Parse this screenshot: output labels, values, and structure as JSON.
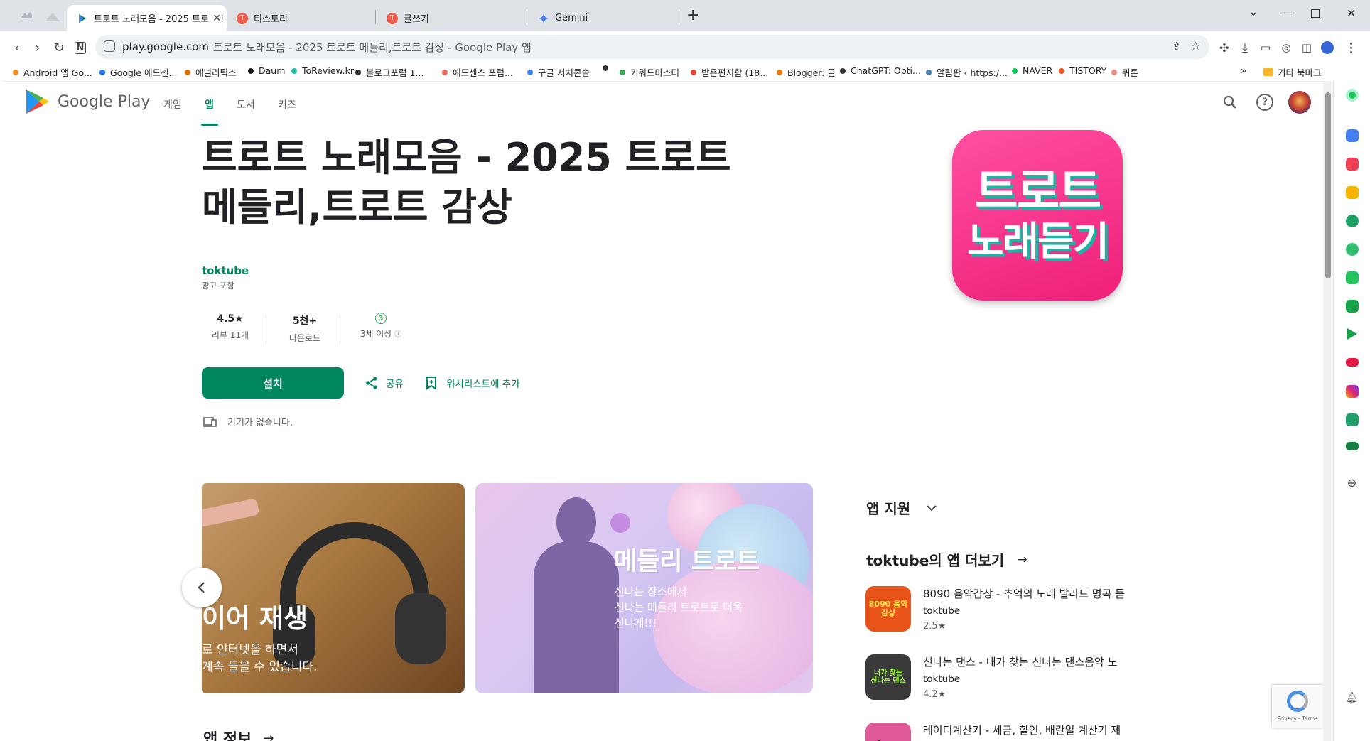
{
  "browser": {
    "tabs": [
      {
        "label": "트로트 노래모음 - 2025 트로트 !",
        "icon": "google-play-icon",
        "active": true
      },
      {
        "label": "티스토리",
        "icon": "tistory-icon",
        "active": false
      },
      {
        "label": "글쓰기",
        "icon": "tistory-icon",
        "active": false
      },
      {
        "label": "Gemini",
        "icon": "gemini-icon",
        "active": false
      }
    ],
    "new_tab": "+",
    "url_host": "play.google.com",
    "url_title": "트로트 노래모음 - 2025 트로트 메들리,트로트 감상 - Google Play 앱",
    "bookmarks": [
      {
        "label": "Android 앱 Go...",
        "color": "#f28b20"
      },
      {
        "label": "Google 애드센...",
        "color": "#1a73e8"
      },
      {
        "label": "애널리틱스",
        "color": "#e37400"
      },
      {
        "label": "Daum",
        "color": "#202124"
      },
      {
        "label": "ToReview.kr",
        "color": "#1fb9a1"
      },
      {
        "label": "블로그포럼 1...",
        "color": "#333333"
      },
      {
        "label": "애드센스 포럼...",
        "color": "#e86b5f"
      },
      {
        "label": "구글 서치콘솔",
        "color": "#4285f4"
      },
      {
        "label": "",
        "color": "#333333"
      },
      {
        "label": "키워드마스터",
        "color": "#34a853"
      },
      {
        "label": "받은편지함 (18...",
        "color": "#ea4335"
      },
      {
        "label": "Blogger: 글",
        "color": "#f57c00"
      },
      {
        "label": "ChatGPT: Opti...",
        "color": "#333333"
      },
      {
        "label": "알림판 ‹ https:/...",
        "color": "#3e7cb1"
      },
      {
        "label": "NAVER",
        "color": "#03c75a"
      },
      {
        "label": "TISTORY",
        "color": "#eb531f"
      },
      {
        "label": "퀴튼",
        "color": "#f28b82"
      }
    ],
    "bookmarks_more": "»",
    "other_bookmarks": "기타 북마크"
  },
  "play": {
    "logo_text": "Google Play",
    "nav": [
      "게임",
      "앱",
      "도서",
      "키즈"
    ],
    "active_nav_index": 1,
    "app_title_line1": "트로트 노래모음 - 2025 트로트",
    "app_title_line2": "메들리,트로트 감상",
    "developer": "toktube",
    "ads_note": "광고 포함",
    "stats": {
      "rating": "4.5★",
      "rating_label": "리뷰 11개",
      "downloads": "5천+",
      "downloads_label": "다운로드",
      "age_badge": "3",
      "age_label": "3세 이상"
    },
    "install_label": "설치",
    "share_label": "공유",
    "wishlist_label": "위시리스트에 추가",
    "no_device": "기기가 없습니다.",
    "app_icon_line1": "트로트",
    "app_icon_line2": "노래듣기",
    "screenshot1": {
      "title": "이어 재생",
      "line1": "로 인터넷을 하면서",
      "line2": "계속 들을 수 있습니다."
    },
    "screenshot2": {
      "title": "메들리 트로트",
      "line1": "신나는 장소에서",
      "line2": "신나는 메들리 트로트로 더욱",
      "line3": "신나게!!!"
    },
    "app_info_heading": "앱 정보",
    "app_support": "앱 지원",
    "more_by": "toktube의 앱 더보기",
    "more_apps": [
      {
        "title": "8090 음악감상 - 추억의 노래 발라드 명곡 듣",
        "dev": "toktube",
        "rating": "2.5★",
        "icon_text": "8090 음악감상",
        "icon_bg": "#e8531a"
      },
      {
        "title": "신나는 댄스 - 내가 찾는 신나는 댄스음악 노",
        "dev": "toktube",
        "rating": "4.2★",
        "icon_text": "내가 찾는 신나는 댄스",
        "icon_bg": "#3a3a3a"
      },
      {
        "title": "레이디계산기 - 세금, 할인, 배란일 계산기 제",
        "dev": "",
        "rating": "",
        "icon_text": "+ −",
        "icon_bg": "#e05a9a"
      }
    ],
    "recaptcha": "Privacy - Terms"
  }
}
